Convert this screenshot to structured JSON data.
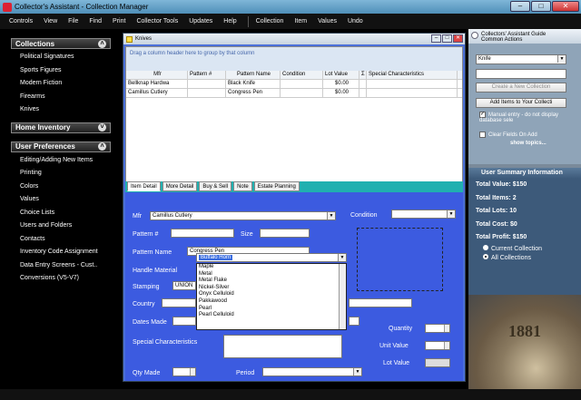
{
  "window": {
    "title": "Collector's Assistant - Collection Manager"
  },
  "menubar": [
    "Controls",
    "View",
    "File",
    "Find",
    "Print",
    "Collector Tools",
    "Updates",
    "Help",
    "Collection",
    "Item",
    "Values",
    "Undo"
  ],
  "sidebar": {
    "collections": {
      "header": "Collections",
      "items": [
        "Political Signatures",
        "Sports Figures",
        "Modern Fiction",
        "Firearms",
        "Knives"
      ]
    },
    "home_inventory": {
      "header": "Home Inventory"
    },
    "user_preferences": {
      "header": "User Preferences",
      "items": [
        "Editing/Adding New Items",
        "Printing",
        "Colors",
        "Values",
        "Choice Lists",
        "Users and Folders",
        "Contacts",
        "Inventory Code Assignment",
        "Data Entry Screens - Cust..",
        "Conversions (V5-V7)"
      ]
    }
  },
  "child_window": {
    "title": "Knives",
    "group_hint": "Drag a column header here to group by that column",
    "columns": [
      "Mfr",
      "Pattern #",
      "Pattern Name",
      "Condition",
      "Lot Value",
      "Σ",
      "Special Characteristics"
    ],
    "rows": [
      {
        "mfr": "Bellknap Hardwa",
        "pattern_no": "",
        "pattern_name": "Black Knife",
        "condition": "",
        "lot_value": "$0.00",
        "sigma": "",
        "special": ""
      },
      {
        "mfr": "Camillus Cutlery",
        "pattern_no": "",
        "pattern_name": "Congress Pen",
        "condition": "",
        "lot_value": "$0.00",
        "sigma": "",
        "special": ""
      }
    ],
    "tabs": [
      "Item Detail",
      "More Detail",
      "Buy & Sell",
      "Note",
      "Estate Planning"
    ],
    "form": {
      "mfr_label": "Mfr",
      "mfr_value": "Camillus Cutlery",
      "condition_label": "Condition",
      "pattern_no_label": "Pattern #",
      "size_label": "Size",
      "pattern_name_label": "Pattern Name",
      "pattern_name_value": "Congress Pen",
      "handle_material_label": "Handle Material",
      "handle_material_value": "Buffalo Horn",
      "stamping_label": "Stamping",
      "stamping_value": "UNION",
      "country_label": "Country",
      "dates_made_label": "Dates Made",
      "quantity_label": "Quantity",
      "special_label": "Special Characteristics",
      "unit_value_label": "Unit Value",
      "lot_value_label": "Lot Value",
      "qty_made_label": "Qty Made",
      "period_label": "Period",
      "handle_options": [
        "Maple",
        "Metal",
        "Metal Flake",
        "Nickel-Silver",
        "Onyx Celluloid",
        "Pakkawood",
        "Pearl",
        "Pearl Celluloid"
      ]
    }
  },
  "right_panel": {
    "header_line1": "Collectors' Assistant Guide",
    "header_line2": "Common Actions",
    "select_value": "Knife",
    "create_button": "Create a New Collection",
    "add_button": "Add Items to Your Collecti",
    "manual_entry": "Manual entry - do not display database sele",
    "clear_fields": "Clear Fields On Add",
    "show_topics": "show topics...",
    "summary": {
      "header": "User Summary Information",
      "total_value": "Total Value: $150",
      "total_items": "Total Items: 2",
      "total_lots": "Total Lots: 10",
      "total_cost": "Total Cost: $0",
      "total_profit": "Total Profit: $150",
      "current_collection": "Current Collection",
      "all_collections": "All Collections"
    },
    "coin_year": "1881"
  }
}
